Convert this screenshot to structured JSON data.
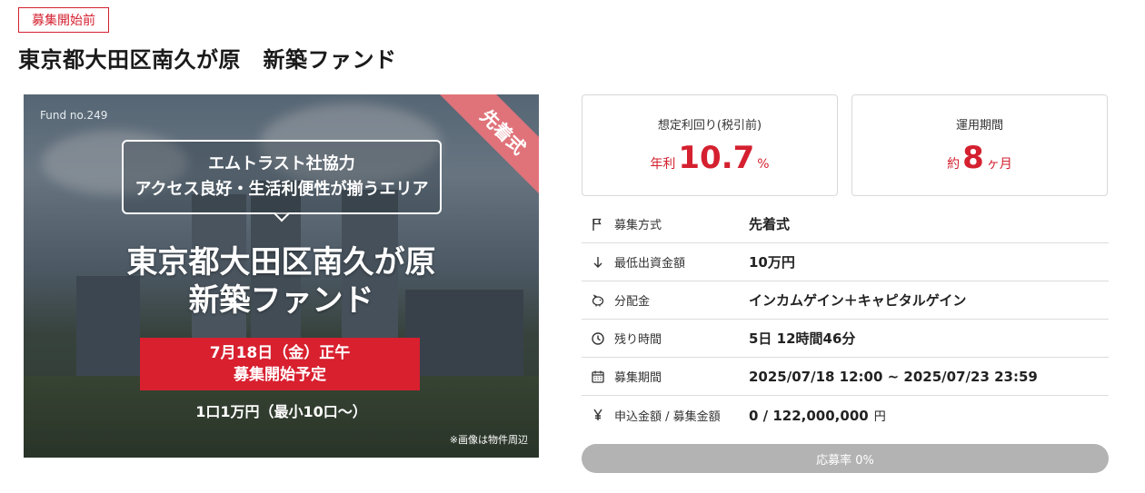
{
  "status_badge": "募集開始前",
  "title": "東京都大田区南久が原　新築ファンド",
  "hero": {
    "fund_no": "Fund no.249",
    "corner_tag": "先着式",
    "bubble_line1": "エムトラスト社協力",
    "bubble_line2": "アクセス良好・生活利便性が揃うエリア",
    "heading_line1": "東京都大田区南久が原",
    "heading_line2": "新築ファンド",
    "band_line1": "7月18日（金）正午",
    "band_line2": "募集開始予定",
    "price": "1口1万円（最小10口〜）",
    "note": "※画像は物件周辺"
  },
  "cards": [
    {
      "label": "想定利回り(税引前)",
      "prefix": "年利",
      "value": "10.7",
      "suffix": "%"
    },
    {
      "label": "運用期間",
      "prefix": "約",
      "value": "8",
      "suffix": "ヶ月"
    }
  ],
  "specs": [
    {
      "icon": "flag-icon",
      "label": "募集方式",
      "value": "先着式",
      "unit": ""
    },
    {
      "icon": "arrow-down-icon",
      "label": "最低出資金額",
      "value": "10万円",
      "unit": ""
    },
    {
      "icon": "piggy-bank-icon",
      "label": "分配金",
      "value": "インカムゲイン＋キャピタルゲイン",
      "unit": ""
    },
    {
      "icon": "clock-icon",
      "label": "残り時間",
      "value": "5日 12時間46分",
      "unit": ""
    },
    {
      "icon": "calendar-icon",
      "label": "募集期間",
      "value": "2025/07/18 12:00 ~ 2025/07/23 23:59",
      "unit": ""
    },
    {
      "icon": "yen-icon",
      "label": "申込金額 / 募集金額",
      "value": "0 / 122,000,000",
      "unit": "円"
    }
  ],
  "progress": {
    "label": "応募率 0%",
    "fraction": 0
  },
  "colors": {
    "accent": "#d4202f",
    "progress_track": "#b3b3b3"
  }
}
